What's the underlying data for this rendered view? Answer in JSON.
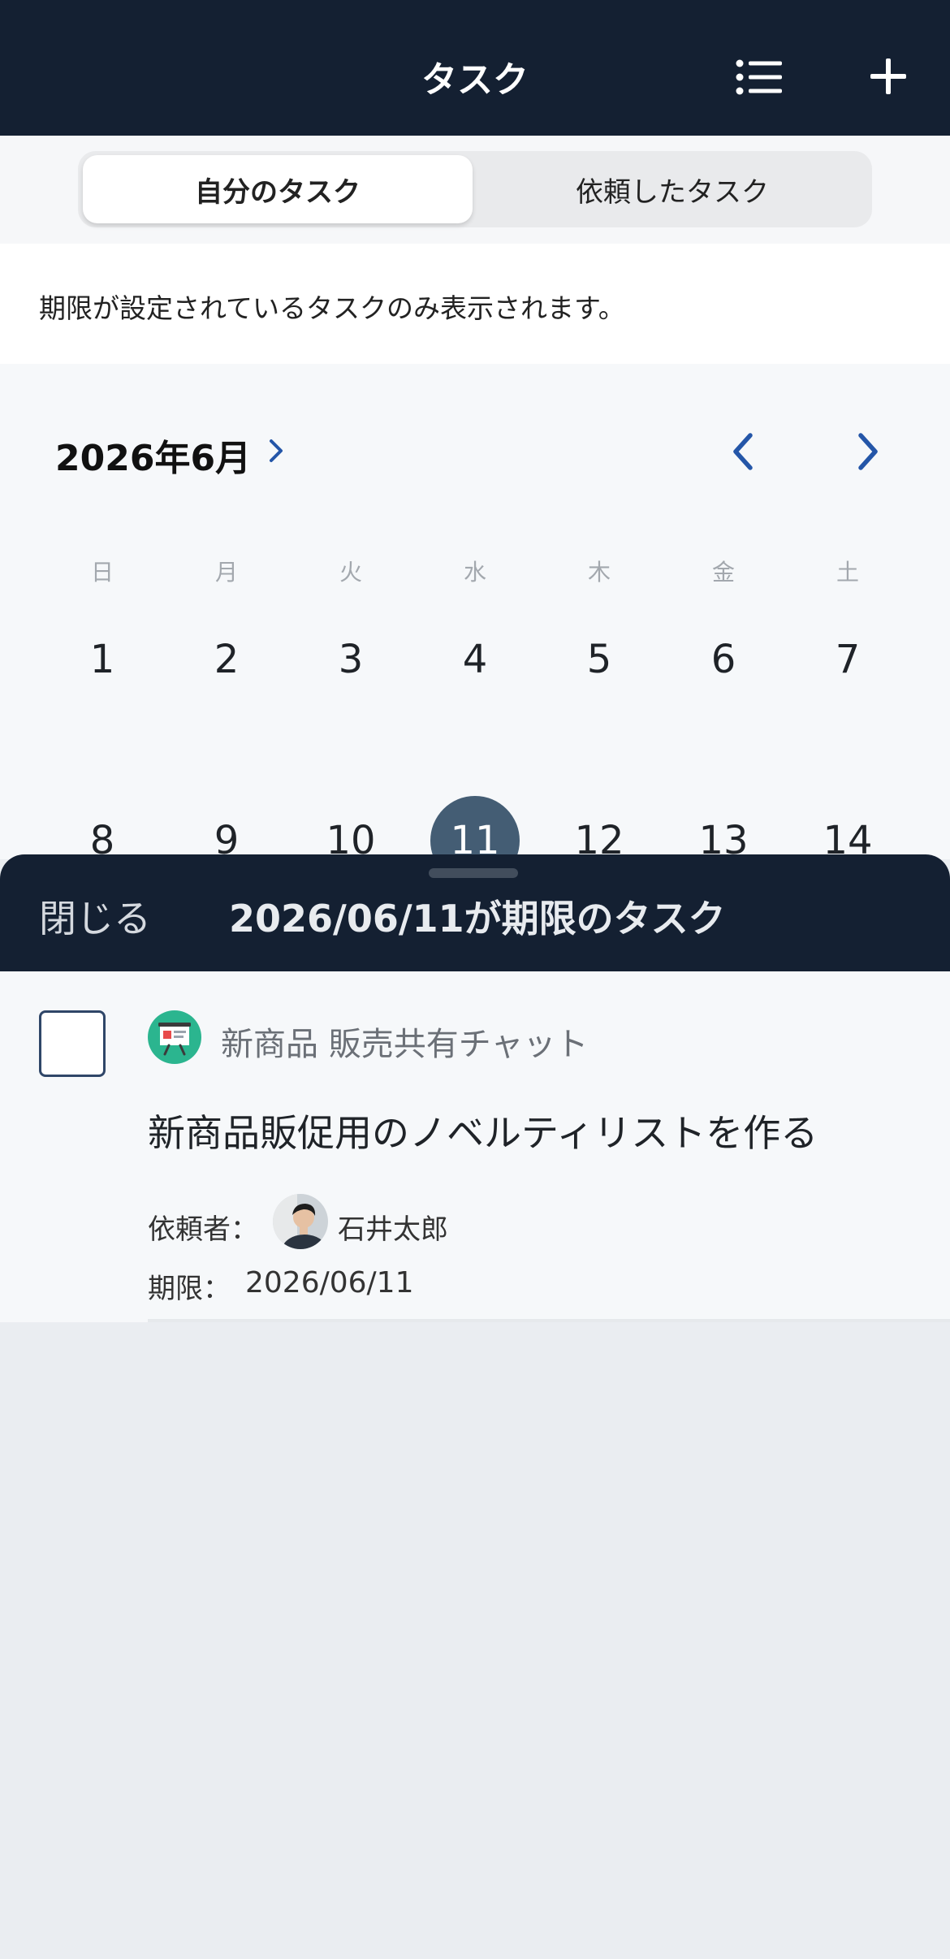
{
  "header": {
    "title": "タスク",
    "list_icon": "list-icon",
    "add_icon": "plus-icon"
  },
  "segment": {
    "my_tasks": "自分のタスク",
    "requested_tasks": "依頼したタスク",
    "selected": "自分のタスク"
  },
  "notice": "期限が設定されているタスクのみ表示されます。",
  "calendar": {
    "month_label": "2026年6月",
    "weekdays": [
      "日",
      "月",
      "火",
      "水",
      "木",
      "金",
      "土"
    ],
    "weeks": [
      [
        "1",
        "2",
        "3",
        "4",
        "5",
        "6",
        "7"
      ],
      [
        "8",
        "9",
        "10",
        "11",
        "12",
        "13",
        "14"
      ]
    ],
    "selected_day": "11"
  },
  "sheet": {
    "close_label": "閉じる",
    "title": "2026/06/11が期限のタスク"
  },
  "task": {
    "chat_name": "新商品 販売共有チャット",
    "title": "新商品販促用のノベルティリストを作る",
    "requester_label": "依頼者：",
    "requester_name": "石井太郎",
    "due_label": "期限：",
    "due_date": "2026/06/11",
    "checked": false
  },
  "colors": {
    "header_bg": "#142032",
    "accent_blue": "#2456a8",
    "selected_day_bg": "#445d74",
    "chat_icon_bg": "#2bb58f"
  }
}
